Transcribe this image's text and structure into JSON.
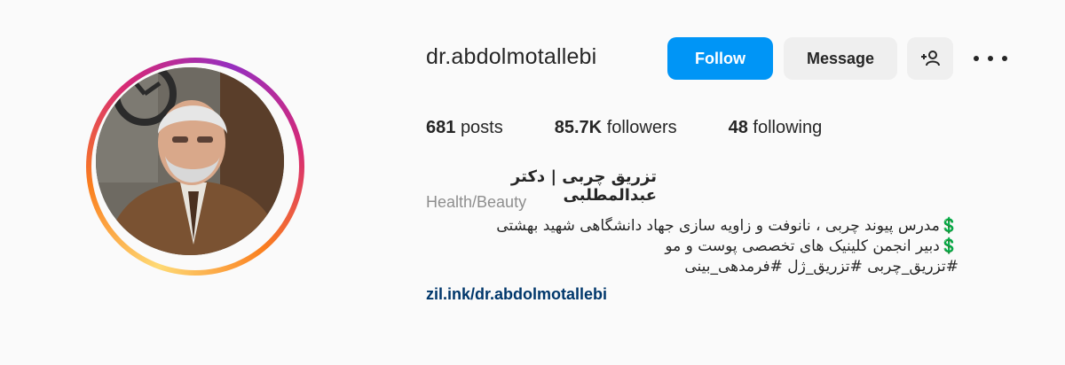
{
  "profile": {
    "username": "dr.abdolmotallebi",
    "follow_label": "Follow",
    "message_label": "Message",
    "suggest_icon": "add-person-icon",
    "more_icon": "more-options-icon"
  },
  "stats": {
    "posts_count": "681",
    "posts_label": "posts",
    "followers_count": "85.7K",
    "followers_label": "followers",
    "following_count": "48",
    "following_label": "following"
  },
  "bio": {
    "name": "تزریق چربی | دکتر عبدالمطلبی",
    "category": "Health/Beauty",
    "lines": [
      "💲مدرس پیوند چربی ، نانوفت و زاویه سازی جهاد دانشگاهی شهید بهشتی",
      "💲دبیر انجمن کلینیک های تخصصی پوست و مو",
      "#تزریق_چربی #تزریق_ژل #فرمدهی_بینی"
    ],
    "link": "zil.ink/dr.abdolmotallebi"
  },
  "colors": {
    "follow_button": "#0095f6",
    "secondary_button": "#efefef",
    "link": "#00376b",
    "muted": "#8e8e8e"
  }
}
